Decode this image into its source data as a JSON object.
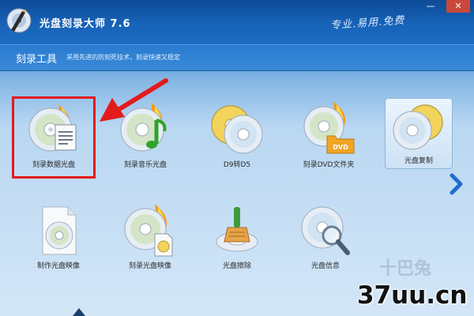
{
  "window": {
    "title": "光盘刻录大师 7.6",
    "slogan": "专业.易用.免费",
    "minimize_glyph": "—",
    "close_glyph": "✕"
  },
  "section": {
    "title": "刻录工具",
    "description": "采用先进的防刻死技术，刻录快速又稳定"
  },
  "tools": [
    {
      "label": "刻录数据光盘",
      "icon": "data-disc-burn-icon",
      "highlighted": true
    },
    {
      "label": "刻录音乐光盘",
      "icon": "music-disc-burn-icon"
    },
    {
      "label": "D9转D5",
      "icon": "d9-to-d5-icon"
    },
    {
      "label": "刻录DVD文件夹",
      "icon": "dvd-folder-burn-icon"
    },
    {
      "label": "光盘复制",
      "icon": "disc-copy-icon",
      "selected": true
    },
    {
      "label": "制作光盘映像",
      "icon": "disc-image-create-icon"
    },
    {
      "label": "刻录光盘映像",
      "icon": "disc-image-burn-icon"
    },
    {
      "label": "光盘擦除",
      "icon": "disc-erase-icon"
    },
    {
      "label": "光盘信息",
      "icon": "disc-info-icon"
    }
  ],
  "dvd_badge": "DVD",
  "watermark": {
    "site": "37uu.cn",
    "faint_text": "十巴兔"
  },
  "colors": {
    "highlight": "#e21b1b",
    "titlebar": "#1763b8",
    "background": "#d3e6f7"
  }
}
